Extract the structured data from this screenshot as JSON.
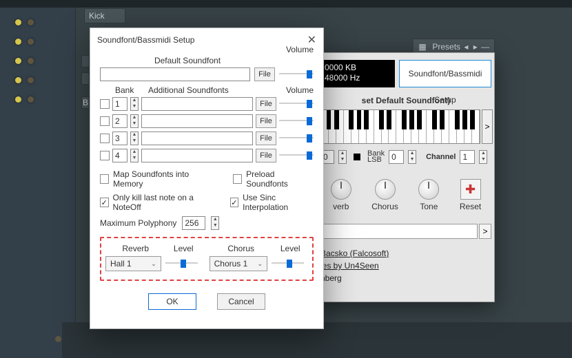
{
  "daw": {
    "track_label": "Kick",
    "channel_B": "B"
  },
  "plugin_chrome": {
    "label": "Presets",
    "grid_glyph": "▦",
    "left": "◂",
    "right": "▸",
    "dash": "—",
    "close": "✕"
  },
  "plugin": {
    "info_line1": "0000 KB",
    "info_line2": "48000 Hz",
    "setup_button": "Soundfont/Bassmidi Setup",
    "default_sf_title": "set Default Soundfont)",
    "scroll_right": ">",
    "bank_lsb_label": "Bank\nLSB",
    "bank_lsb_value": "0",
    "channel_label": "Channel",
    "channel_value": "1",
    "num_value_a": "0",
    "knobs": {
      "verb": "verb",
      "chorus": "Chorus",
      "tone": "Tone"
    },
    "reset_label": "Reset",
    "reset_glyph": "✚",
    "chevron": ">",
    "credits_line1": "Bacsko (Falcosoft)",
    "credits_line2": "ies by Un4Seen",
    "credits_line3": "nberg"
  },
  "dialog": {
    "title": "Soundfont/Bassmidi Setup",
    "close_glyph": "✕",
    "default_sf_label": "Default Soundfont",
    "volume_label": "Volume",
    "file_label": "File",
    "bank_header": "Bank",
    "additional_header": "Additional Soundfonts",
    "rows": [
      {
        "bank": "1"
      },
      {
        "bank": "2"
      },
      {
        "bank": "3"
      },
      {
        "bank": "4"
      }
    ],
    "spin_up": "▲",
    "spin_dn": "▼",
    "opts": {
      "map": "Map Soundfonts into Memory",
      "preload": "Preload Soundfonts",
      "only_kill": "Only kill last note on a NoteOff",
      "sinc": "Use Sinc Interpolation"
    },
    "max_poly_label": "Maximum Polyphony",
    "max_poly_value": "256",
    "fx": {
      "reverb_label": "Reverb",
      "level_label": "Level",
      "chorus_label": "Chorus",
      "reverb_value": "Hall 1",
      "chorus_value": "Chorus 1",
      "combo_arrow": "⌄"
    },
    "ok": "OK",
    "cancel": "Cancel"
  }
}
